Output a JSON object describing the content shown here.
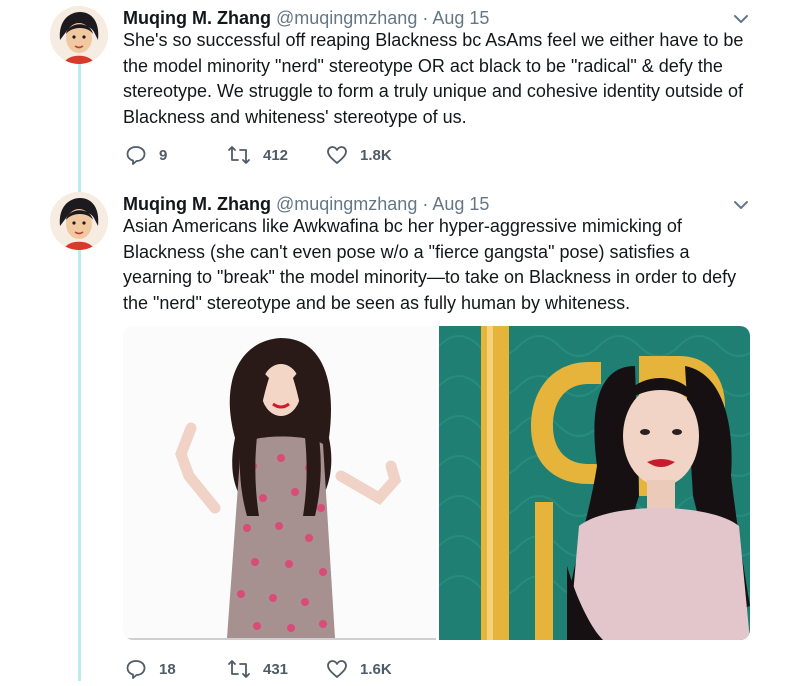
{
  "tweets": [
    {
      "author_name": "Muqing M. Zhang",
      "handle": "@muqingmzhang",
      "separator": "·",
      "date": "Aug 15",
      "text": "She's so successful off reaping Blackness bc AsAms feel we either have to be the model minority \"nerd\" stereotype OR act black to be \"radical\" & defy the stereotype. We struggle to form a truly unique and cohesive identity outside of Blackness and whiteness' stereotype of us.",
      "replies": "9",
      "retweets": "412",
      "likes": "1.8K"
    },
    {
      "author_name": "Muqing M. Zhang",
      "handle": "@muqingmzhang",
      "separator": "·",
      "date": "Aug 15",
      "text": "Asian Americans like Awkwafina bc her hyper-aggressive mimicking of Blackness (she can't even pose w/o a \"fierce gangsta\" pose) satisfies a yearning to \"break\" the model minority—to take on Blackness in order to defy the \"nerd\" stereotype and be seen as fully human by whiteness.",
      "replies": "18",
      "retweets": "431",
      "likes": "1.6K"
    }
  ],
  "icons": {
    "avatar": "cartoon-avatar",
    "caret": "chevron-down-icon",
    "reply": "reply-icon",
    "retweet": "retweet-icon",
    "like": "heart-icon"
  },
  "colors": {
    "thread_line": "#b9ecec",
    "secondary_text": "#657786",
    "action_text": "#4f5b66"
  }
}
